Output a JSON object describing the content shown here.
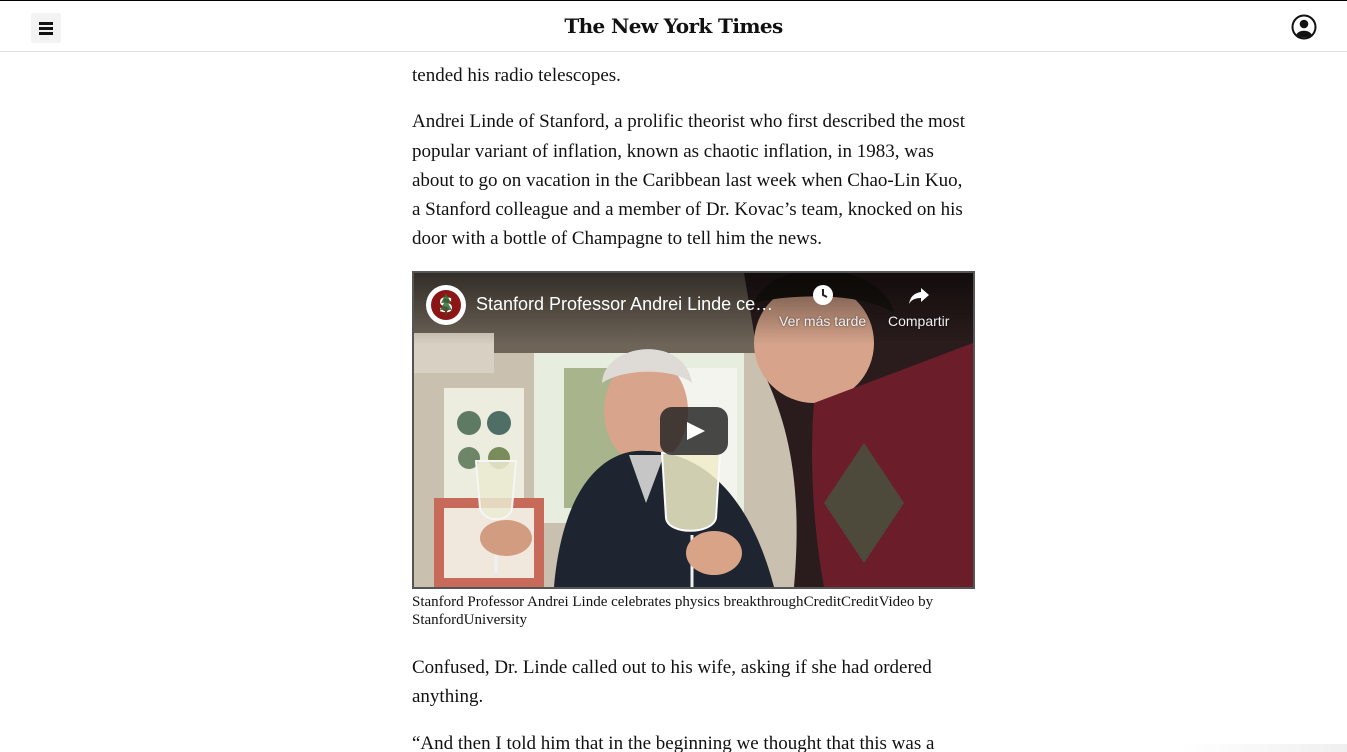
{
  "header": {
    "logo_text": "The New York Times",
    "menu_icon": "hamburger-menu-icon",
    "account_icon": "user-account-icon"
  },
  "article": {
    "paragraph_top_clipped": "…, …, tended his radio telescopes.",
    "paragraph_top_visible": "tended his radio telescopes.",
    "paragraph_linde_lines": [
      "Andrei Linde of Stanford, a prolific theorist who first described the most",
      "popular variant of inflation, known as chaotic inflation, in 1983, was",
      "about to go on vacation in the Caribbean last week when Chao-Lin Kuo,",
      "a Stanford colleague and a member of Dr. Kovac’s team, knocked on his",
      "door with a bottle of Champagne to tell him the news."
    ],
    "paragraph_confused_lines": [
      "Confused, Dr. Linde called out to his wife, asking if she had ordered",
      "anything."
    ],
    "paragraph_quote_start": "“And then I told him that in the beginning we thought that this was a"
  },
  "video": {
    "title": "Stanford Professor Andrei Linde ce…",
    "watch_later_label": "Ver más tarde",
    "share_label": "Compartir",
    "channel_logo_icon": "stanford-tree-logo-icon",
    "watch_later_icon": "clock-icon",
    "share_icon": "share-arrow-icon",
    "play_icon": "play-icon"
  },
  "caption": {
    "text": "Stanford Professor Andrei Linde celebrates physics breakthrough",
    "credit_labels": "CreditCredit",
    "credit": "Video by StanfordUniversity"
  },
  "colors": {
    "text": "#111111",
    "header_border": "#e2e2e2",
    "menu_button_bg": "#f3f3f3",
    "stanford_red": "#8c1515",
    "video_border": "#555555"
  }
}
